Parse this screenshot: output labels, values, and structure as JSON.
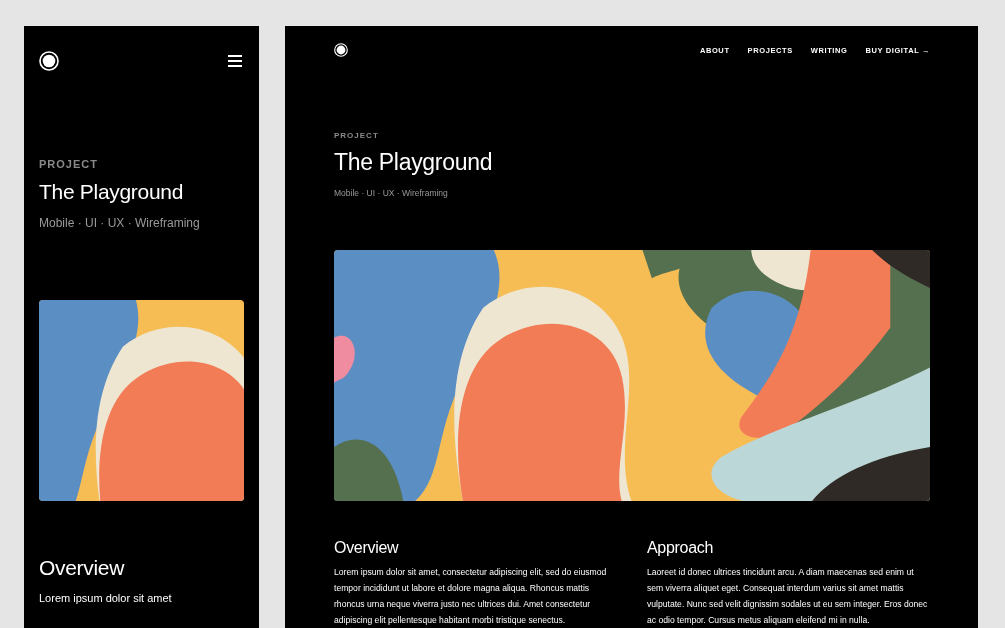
{
  "mobile": {
    "label": "PROJECT",
    "title": "The Playground",
    "tags": "Mobile · UI · UX · Wireframing",
    "section_heading": "Overview",
    "section_text": "Lorem ipsum dolor sit amet"
  },
  "desktop": {
    "nav": [
      "ABOUT",
      "PROJECTS",
      "WRITING",
      "BUY DIGITAL →"
    ],
    "label": "PROJECT",
    "title": "The Playground",
    "tags": "Mobile · UI · UX · Wireframing",
    "sections": [
      {
        "heading": "Overview",
        "text": "Lorem ipsum dolor sit amet, consectetur adipiscing elit, sed do eiusmod tempor incididunt ut labore et dolore magna aliqua. Rhoncus mattis rhoncus urna neque viverra justo nec ultrices dui. Amet consectetur adipiscing elit pellentesque habitant morbi tristique senectus."
      },
      {
        "heading": "Approach",
        "text": "Laoreet id donec ultrices tincidunt arcu. A diam maecenas sed enim ut sem viverra aliquet eget. Consequat interdum varius sit amet mattis vulputate. Nunc sed velit dignissim sodales ut eu sem integer. Eros donec ac odio tempor. Cursus metus aliquam eleifend mi in nulla."
      }
    ]
  }
}
